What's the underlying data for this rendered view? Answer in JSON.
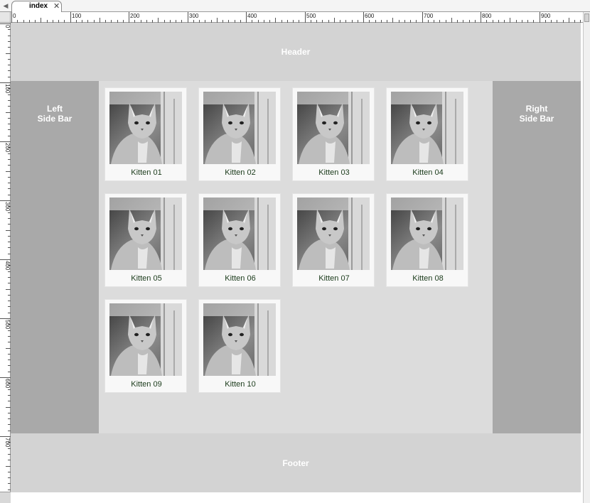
{
  "tabbar": {
    "scroll_left_icon": "triangle-left-icon",
    "active_tab": {
      "label": "index",
      "close_icon": "close-icon"
    }
  },
  "ruler": {
    "horizontal_labels": [
      "0",
      "100",
      "200",
      "300",
      "400",
      "500",
      "600",
      "700",
      "800",
      "900"
    ],
    "vertical_labels": [
      "0",
      "100",
      "200",
      "300",
      "400",
      "500",
      "600",
      "700"
    ]
  },
  "page": {
    "header": "Header",
    "left_sidebar": [
      "Left",
      "Side Bar"
    ],
    "right_sidebar": [
      "Right",
      "Side Bar"
    ],
    "footer": "Footer"
  },
  "gallery": {
    "items": [
      {
        "caption": "Kitten 01"
      },
      {
        "caption": "Kitten 02"
      },
      {
        "caption": "Kitten 03"
      },
      {
        "caption": "Kitten 04"
      },
      {
        "caption": "Kitten 05"
      },
      {
        "caption": "Kitten 06"
      },
      {
        "caption": "Kitten 07"
      },
      {
        "caption": "Kitten 08"
      },
      {
        "caption": "Kitten 09"
      },
      {
        "caption": "Kitten 10"
      }
    ]
  },
  "colors": {
    "header_footer": "#d3d3d3",
    "sidebars": "#a9a9a9",
    "main_bg": "#dcdcdc",
    "card_bg": "#f8f8f8",
    "caption_text": "#1a3a1a"
  }
}
